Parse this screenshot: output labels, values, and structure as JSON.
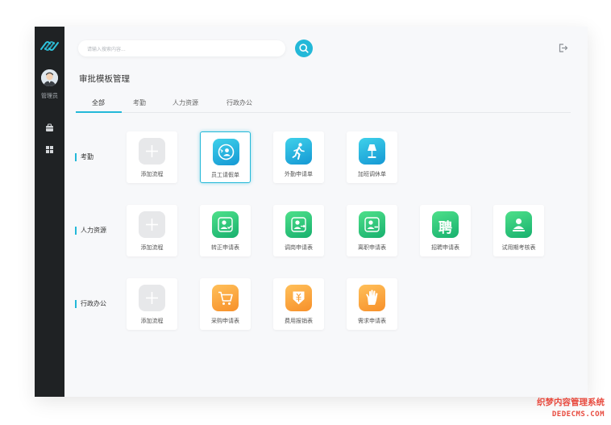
{
  "sidebar": {
    "user_label": "管理员",
    "logo_icon": "link-logo-icon",
    "items": [
      {
        "icon": "briefcase-icon"
      },
      {
        "icon": "grid-icon"
      }
    ]
  },
  "header": {
    "search_placeholder": "请输入搜索内容...",
    "search_icon": "search-icon",
    "logout_icon": "logout-icon"
  },
  "page_title": "审批模板管理",
  "tabs": [
    {
      "label": "全部",
      "active": true
    },
    {
      "label": "考勤",
      "active": false
    },
    {
      "label": "人力资源",
      "active": false
    },
    {
      "label": "行政办公",
      "active": false
    }
  ],
  "sections": [
    {
      "label": "考勤",
      "cards": [
        {
          "label": "添加流程",
          "icon": "plus-icon",
          "color": "#e7e8ea"
        },
        {
          "label": "员工请假单",
          "icon": "person-clock-icon",
          "color": "#1fb0e0",
          "selected": true
        },
        {
          "label": "外勤申请单",
          "icon": "walking-person-icon",
          "color": "#1fb0e0"
        },
        {
          "label": "加班调休单",
          "icon": "lamp-icon",
          "color": "#1fb0e0"
        }
      ]
    },
    {
      "label": "人力资源",
      "cards": [
        {
          "label": "添加流程",
          "icon": "plus-icon",
          "color": "#e7e8ea"
        },
        {
          "label": "转正申请表",
          "icon": "person-check-icon",
          "color": "#2cc77a"
        },
        {
          "label": "调岗申请表",
          "icon": "person-swap-icon",
          "color": "#2cc77a"
        },
        {
          "label": "离职申请表",
          "icon": "person-leave-icon",
          "color": "#2cc77a"
        },
        {
          "label": "招聘申请表",
          "icon": "hire-character-icon",
          "glyph": "聘",
          "color": "#2cc77a"
        },
        {
          "label": "试用期考核表",
          "icon": "person-badge-icon",
          "color": "#2cc77a"
        }
      ]
    },
    {
      "label": "行政办公",
      "cards": [
        {
          "label": "添加流程",
          "icon": "plus-icon",
          "color": "#e7e8ea"
        },
        {
          "label": "采购申请表",
          "icon": "cart-icon",
          "color": "#f8a03a"
        },
        {
          "label": "费用报销表",
          "icon": "money-down-icon",
          "color": "#f8a03a"
        },
        {
          "label": "需求申请表",
          "icon": "hand-icon",
          "color": "#f8a03a"
        }
      ]
    }
  ],
  "watermark": {
    "line1": "织梦内容管理系统",
    "line2": "DEDECMS.COM"
  },
  "colors": {
    "accent": "#23b8d8",
    "sidebar": "#1f2224"
  }
}
